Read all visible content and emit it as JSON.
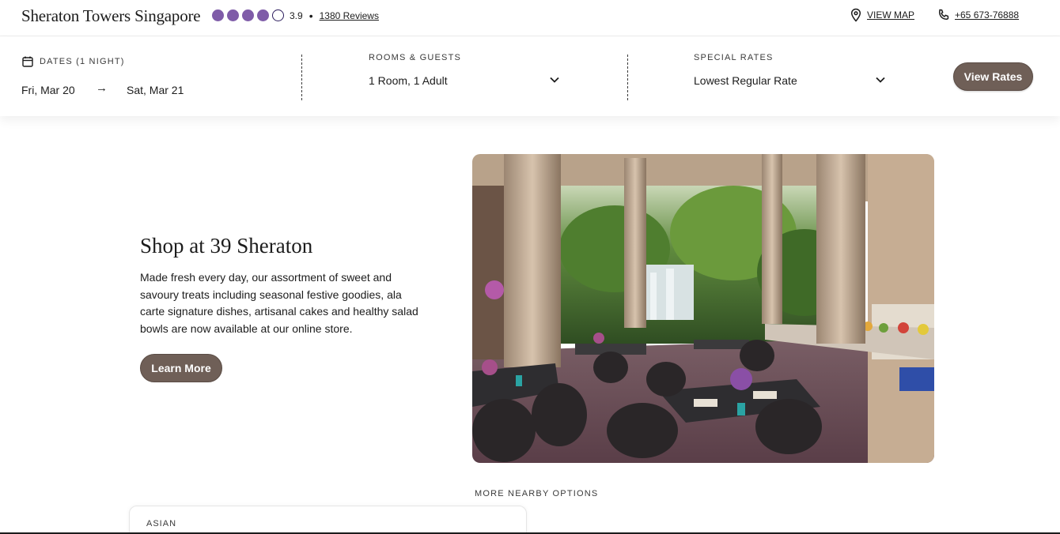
{
  "header": {
    "hotel_name": "Sheraton Towers Singapore",
    "rating_value": "3.9",
    "rating_fraction": 0.78,
    "rating_dots_filled": 4,
    "rating_dots_total": 5,
    "bullet": "•",
    "reviews_label": "1380 Reviews",
    "map_label": "VIEW MAP",
    "phone_label": "+65 673-76888"
  },
  "booking": {
    "dates_label": "DATES (1 NIGHT)",
    "date_from": "Fri, Mar 20",
    "arrow": "→",
    "date_to": "Sat, Mar 21",
    "rooms_label": "ROOMS & GUESTS",
    "rooms_value": "1 Room, 1 Adult",
    "rates_label": "SPECIAL RATES",
    "rates_value": "Lowest Regular Rate",
    "view_rates_label": "View Rates"
  },
  "feature": {
    "title": "Shop at 39 Sheraton",
    "description": "Made fresh every day, our assortment of sweet and savoury treats including seasonal festive goodies, ala carte signature dishes, artisanal cakes and healthy salad bowls are now available at our online store.",
    "button_label": "Learn More"
  },
  "nearby": {
    "heading": "MORE NEARBY OPTIONS",
    "card_tag": "ASIAN"
  },
  "colors": {
    "accent_button": "#6f5f57",
    "rating_dot": "#7f5ca8",
    "text": "#1c1c1c"
  },
  "icons": [
    "location-pin-icon",
    "phone-icon",
    "calendar-icon",
    "chevron-down-icon"
  ]
}
